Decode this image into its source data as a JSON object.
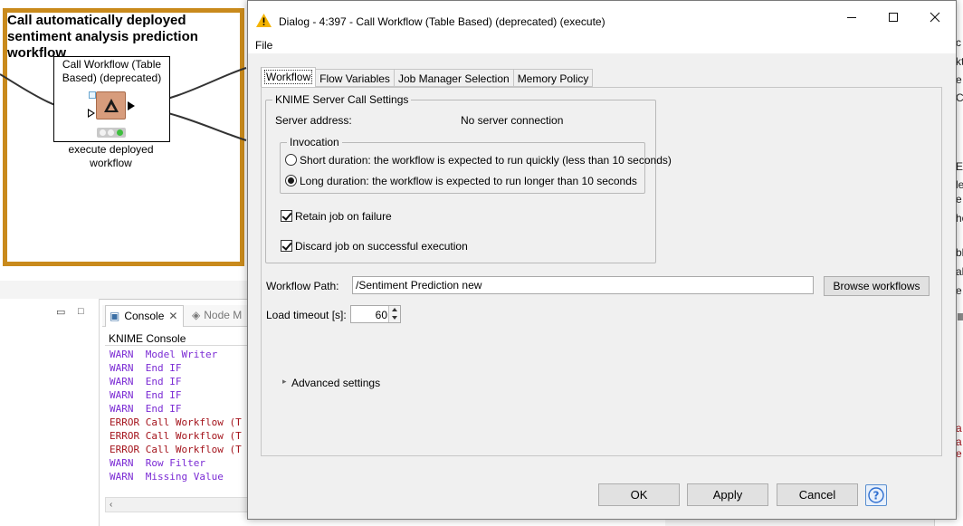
{
  "workbench": {
    "annotation_text": "Call automatically deployed sentiment analysis prediction workflow",
    "node": {
      "title": "Call Workflow (Table Based) (deprecated)",
      "label": "execute deployed workflow"
    },
    "views": {
      "console_tab": "Console",
      "node_monitor_tab": "Node M",
      "console_title": "KNIME Console",
      "lines": [
        {
          "level": "WARN",
          "text": " Model Writer",
          "type": "warn"
        },
        {
          "level": "WARN",
          "text": " End IF",
          "type": "warn"
        },
        {
          "level": "WARN",
          "text": " End IF",
          "type": "warn"
        },
        {
          "level": "WARN",
          "text": " End IF",
          "type": "warn"
        },
        {
          "level": "WARN",
          "text": " End IF",
          "type": "warn"
        },
        {
          "level": "ERROR",
          "text": "Call Workflow (T",
          "type": "error"
        },
        {
          "level": "ERROR",
          "text": "Call Workflow (T",
          "type": "error"
        },
        {
          "level": "ERROR",
          "text": "Call Workflow (T",
          "type": "error"
        },
        {
          "level": "WARN",
          "text": " Row Filter",
          "type": "warn"
        },
        {
          "level": "WARN",
          "text": " Missing Value",
          "type": "warn"
        }
      ]
    },
    "right_snippets": [
      "c",
      "kt",
      "e",
      "C",
      "E",
      "le",
      "e",
      "ho",
      "bl",
      "al",
      "e",
      "a",
      "a",
      "e"
    ]
  },
  "dialog": {
    "title": "Dialog - 4:397 - Call Workflow (Table Based) (deprecated) (execute)",
    "menu": {
      "file": "File"
    },
    "tabs": [
      "Workflow",
      "Flow Variables",
      "Job Manager Selection",
      "Memory Policy"
    ],
    "server_group": {
      "legend": "KNIME Server Call Settings",
      "server_address_label": "Server address:",
      "server_address_value": "No server connection",
      "invocation": {
        "legend": "Invocation",
        "short_label": "Short duration: the workflow is expected to run quickly (less than 10 seconds)",
        "long_label": "Long duration: the workflow is expected to run longer than 10 seconds",
        "selected": "long"
      },
      "retain_label": "Retain job on failure",
      "retain_checked": true,
      "discard_label": "Discard job on successful execution",
      "discard_checked": true
    },
    "workflow_path_label": "Workflow Path:",
    "workflow_path_value": "/Sentiment Prediction new",
    "browse_label": "Browse workflows",
    "load_timeout_label": "Load timeout [s]:",
    "load_timeout_value": "60",
    "advanced_label": "Advanced settings",
    "buttons": {
      "ok": "OK",
      "apply": "Apply",
      "cancel": "Cancel"
    }
  }
}
